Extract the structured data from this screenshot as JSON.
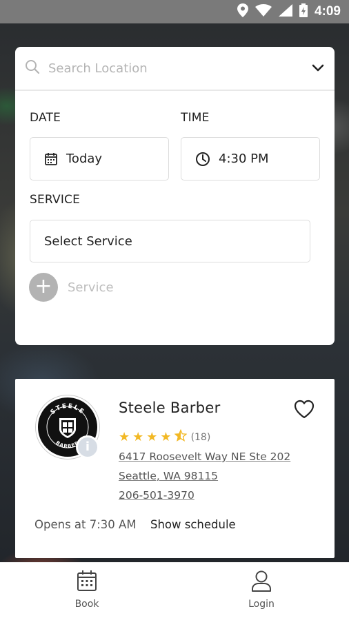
{
  "status_bar": {
    "time": "4:09"
  },
  "search": {
    "placeholder": "Search Location",
    "date_label": "DATE",
    "date_value": "Today",
    "time_label": "TIME",
    "time_value": "4:30 PM",
    "service_label": "SERVICE",
    "service_value": "Select Service",
    "add_service_label": "Service"
  },
  "shop": {
    "name": "Steele Barber",
    "rating": 4.5,
    "reviews": "(18)",
    "address_line1": "6417 Roosevelt Way NE Ste 202",
    "address_line2": "Seattle, WA 98115",
    "phone": "206-501-3970",
    "opens": "Opens at 7:30 AM",
    "schedule_link": "Show schedule",
    "logo_top_text": "STEELE",
    "logo_bottom_text": "BARBER"
  },
  "nav": {
    "items": [
      {
        "label": "Book",
        "icon": "calendar-icon"
      },
      {
        "label": "Login",
        "icon": "user-icon"
      }
    ]
  },
  "colors": {
    "star": "#f2b824",
    "status_bar": "#7a7a7a",
    "placeholder": "#b4b4b4"
  }
}
